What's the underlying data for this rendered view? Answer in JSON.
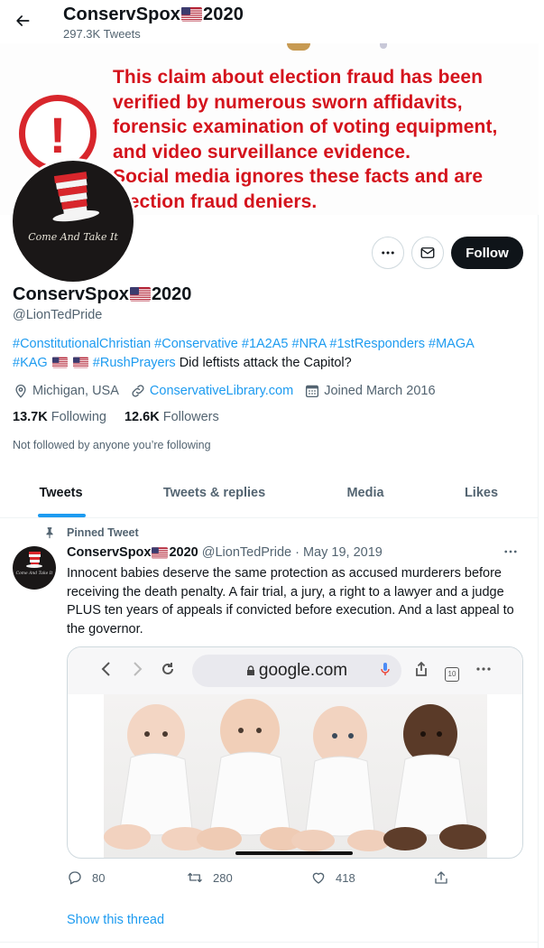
{
  "header": {
    "title": "ConservSpox",
    "title_suffix": "2020",
    "tweet_count": "297.3K Tweets",
    "back_icon": "arrow-left-icon"
  },
  "banner": {
    "text": "This claim about election fraud has been\nverified by numerous sworn affidavits,\nforensic examination of voting equipment,\nand video surveillance evidence.\nSocial media ignores these facts and are\nelection fraud deniers.",
    "warning_mark": "!",
    "text_color": "#d4131c"
  },
  "profile": {
    "avatar_text": "Come And Take It",
    "name": "ConservSpox",
    "name_suffix": "2020",
    "handle": "@LionTedPride",
    "bio_hashtags_1": "#ConstitutionalChristian #Conservative #1A2A5 #NRA #1stResponders #MAGA",
    "bio_hashtag_kag": "#KAG",
    "bio_hashtag_rush": "#RushPrayers",
    "bio_text": "Did leftists attack the Capitol?",
    "location": "Michigan, USA",
    "website": "ConservativeLibrary.com",
    "joined": "Joined March 2016",
    "following_count": "13.7K",
    "following_label": "Following",
    "followers_count": "12.6K",
    "followers_label": "Followers",
    "not_followed": "Not followed by anyone you’re following"
  },
  "buttons": {
    "more_icon": "more-horizontal-icon",
    "message_icon": "envelope-icon",
    "follow": "Follow"
  },
  "tabs": [
    {
      "label": "Tweets",
      "active": true
    },
    {
      "label": "Tweets & replies",
      "active": false
    },
    {
      "label": "Media",
      "active": false
    },
    {
      "label": "Likes",
      "active": false
    }
  ],
  "tweet": {
    "pinned_label": "Pinned Tweet",
    "author_name": "ConservSpox",
    "author_suffix": "2020",
    "author_handle": "@LionTedPride",
    "separator": "·",
    "date": "May 19, 2019",
    "avatar_text": "Come And Take It",
    "text": "Innocent babies deserve the same protection as accused  murderers before receiving the death penalty.  A fair trial, a jury, a right to a lawyer and a judge PLUS ten years of appeals if convicted before execution.  And a last appeal to the governor.",
    "media": {
      "url_text": "google.com",
      "tab_count": "10"
    },
    "replies": "80",
    "retweets": "280",
    "likes": "418",
    "show_thread": "Show this thread"
  },
  "colors": {
    "accent": "#1d9bf0",
    "text_primary": "#0f1419",
    "text_secondary": "#536471",
    "warning_red": "#d8262c"
  }
}
